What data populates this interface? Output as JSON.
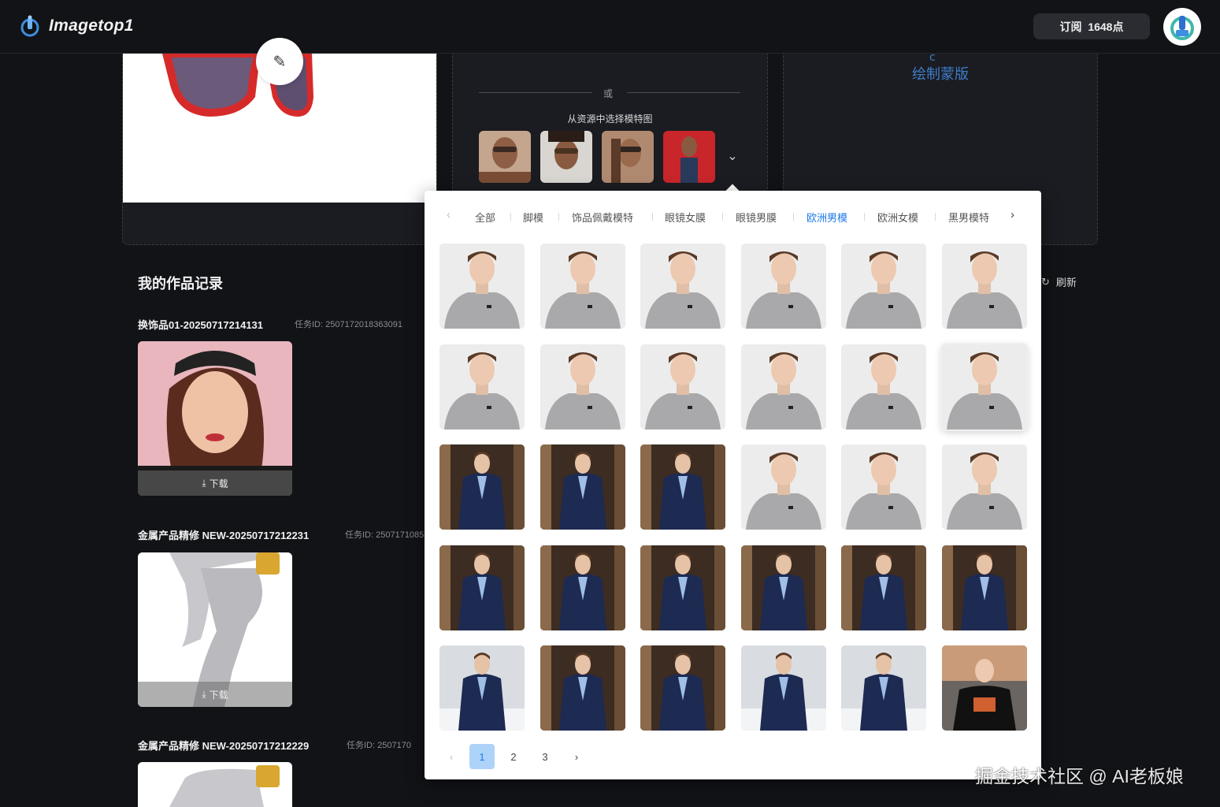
{
  "header": {
    "app_name": "Imagetop1",
    "subscribe_label": "订阅",
    "points_label": "1648点"
  },
  "model_panel": {
    "or_text": "或",
    "pick_label": "从资源中选择模特图"
  },
  "mask_panel": {
    "draw_mask_label": "绘制蒙版"
  },
  "works": {
    "title": "我的作品记录",
    "refresh_label": "刷新",
    "download_label": "下载",
    "items": [
      {
        "name": "换饰品01-20250717214131",
        "task_id": "任务ID: 2507172018363091"
      },
      {
        "name": "金属产品精修 NEW-20250717212231",
        "task_id": "任务ID: 2507171085"
      },
      {
        "name": "金属产品精修 NEW-20250717212229",
        "task_id": "任务ID: 2507170"
      }
    ]
  },
  "popup": {
    "tabs": [
      "全部",
      "脚模",
      "饰品佩戴模特",
      "眼镜女膜",
      "眼镜男膜",
      "欧洲男模",
      "欧洲女模",
      "黑男模特"
    ],
    "active_tab": "欧洲男模",
    "pages": [
      "1",
      "2",
      "3"
    ],
    "current_page": "1",
    "grid": [
      [
        "sweater",
        "sweater",
        "sweater",
        "sweater",
        "sweater",
        "sweater"
      ],
      [
        "sweater",
        "sweater",
        "sweater",
        "sweater",
        "sweater",
        "sweater"
      ],
      [
        "suit",
        "suit",
        "suit",
        "sweater",
        "sweater",
        "sweater"
      ],
      [
        "suit",
        "suit",
        "suit",
        "suit",
        "suit",
        "suit"
      ],
      [
        "suit-runway",
        "suit",
        "suit",
        "suit-runway",
        "suit-runway",
        "tshirt"
      ]
    ],
    "selected_cell": "row1-col5"
  },
  "watermark": "掘金技术社区 @ AI老板娘",
  "colors": {
    "accent": "#1f7ae8",
    "background": "#121317",
    "panel": "#1b1c21",
    "mask_link": "#3f7dc9"
  }
}
